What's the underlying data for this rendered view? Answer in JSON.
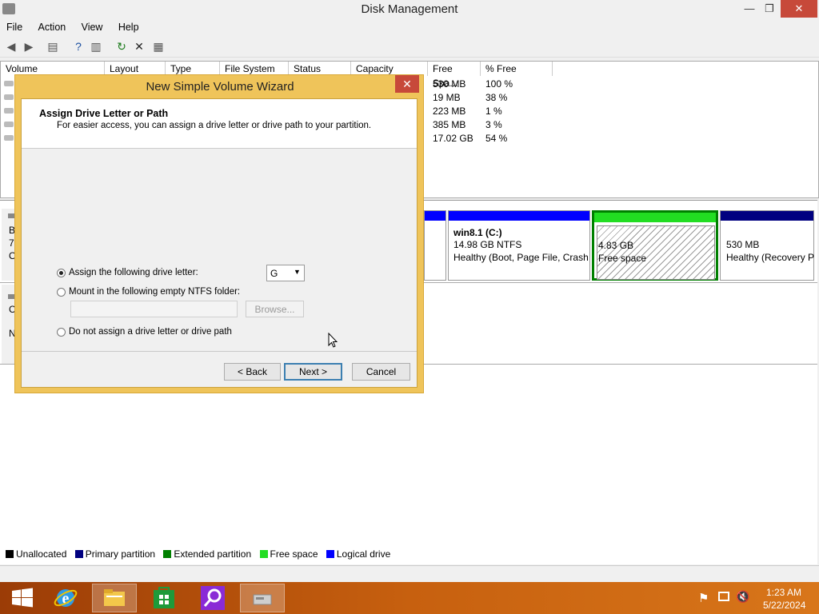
{
  "window": {
    "title": "Disk Management",
    "min": "—",
    "restore": "❐",
    "close": "✕"
  },
  "menu": [
    "File",
    "Action",
    "View",
    "Help"
  ],
  "toolbar": {
    "icons": [
      "back-icon",
      "forward-icon",
      "console-tree-icon",
      "help-icon",
      "properties-icon",
      "refresh-icon",
      "delete-icon",
      "settings-icon"
    ]
  },
  "columns": [
    "Volume",
    "Layout",
    "Type",
    "File System",
    "Status",
    "Capacity",
    "Free Spa...",
    "% Free"
  ],
  "volumes": [
    {
      "free": "530 MB",
      "pct": "100 %"
    },
    {
      "free": "19 MB",
      "pct": "38 %"
    },
    {
      "free": "223 MB",
      "pct": "1 %"
    },
    {
      "free": "385 MB",
      "pct": "3 %"
    },
    {
      "free": "17.02 GB",
      "pct": "54 %"
    }
  ],
  "disk_left": {
    "b": "B",
    "seven": "7(",
    "o": "O",
    "c": "C",
    "n": "N"
  },
  "partitions": {
    "c": {
      "name": "win8.1  (C:)",
      "size": "14.98 GB NTFS",
      "status": "Healthy (Boot, Page File, Crash"
    },
    "free": {
      "size": "4.83 GB",
      "label": "Free space"
    },
    "recovery": {
      "size": "530 MB",
      "status": "Healthy (Recovery P"
    }
  },
  "legend": [
    "Unallocated",
    "Primary partition",
    "Extended partition",
    "Free space",
    "Logical drive"
  ],
  "colors": {
    "unallocated": "#000000",
    "primary": "#000080",
    "extended": "#008000",
    "free": "#22dd22",
    "logical": "#0000ff",
    "accent": "#efc45a"
  },
  "wizard": {
    "title": "New Simple Volume Wizard",
    "close": "✕",
    "heading": "Assign Drive Letter or Path",
    "subheading": "For easier access, you can assign a drive letter or drive path to your partition.",
    "opt_assign": "Assign the following drive letter:",
    "drive_letter": "G",
    "opt_mount": "Mount in the following empty NTFS folder:",
    "browse": "Browse...",
    "opt_none": "Do not assign a drive letter or drive path",
    "back": "< Back",
    "next": "Next >",
    "cancel": "Cancel"
  },
  "taskbar": {
    "apps": [
      "start-icon",
      "internet-explorer-icon",
      "file-explorer-icon",
      "store-icon",
      "search-app-icon",
      "disk-management-icon"
    ],
    "time": "1:23 AM",
    "date": "5/22/2024"
  }
}
